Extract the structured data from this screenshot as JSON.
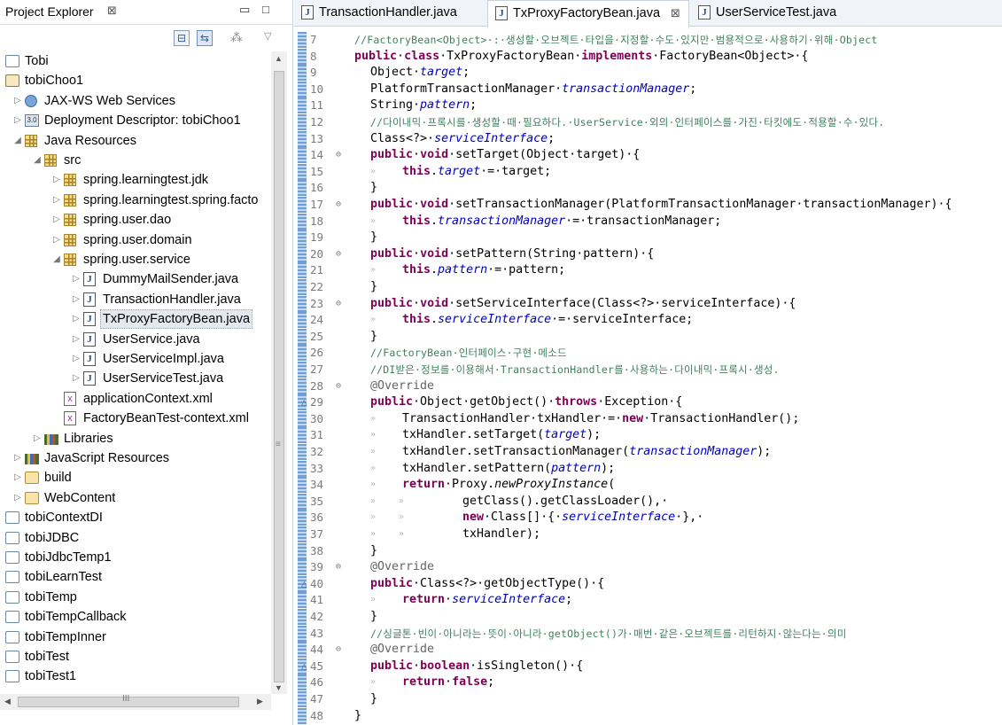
{
  "explorer": {
    "title": "Project Explorer",
    "close_glyph": "⊠",
    "items": [
      {
        "label": "Tobi",
        "icon": "project-folder-icon",
        "depth": 0,
        "twisty": ""
      },
      {
        "label": "tobiChoo1",
        "icon": "web-project-icon",
        "depth": 0,
        "twisty": ""
      },
      {
        "label": "JAX-WS Web Services",
        "icon": "web-services-icon",
        "depth": 1,
        "twisty": "▷"
      },
      {
        "label": "Deployment Descriptor: tobiChoo1",
        "icon": "deployment-descriptor-icon",
        "depth": 1,
        "twisty": "▷"
      },
      {
        "label": "Java Resources",
        "icon": "java-resources-icon",
        "depth": 1,
        "twisty": "◢"
      },
      {
        "label": "src",
        "icon": "source-folder-icon",
        "depth": 2,
        "twisty": "◢"
      },
      {
        "label": "spring.learningtest.jdk",
        "icon": "package-icon",
        "depth": 3,
        "twisty": "▷"
      },
      {
        "label": "spring.learningtest.spring.facto",
        "icon": "package-icon",
        "depth": 3,
        "twisty": "▷"
      },
      {
        "label": "spring.user.dao",
        "icon": "package-icon",
        "depth": 3,
        "twisty": "▷"
      },
      {
        "label": "spring.user.domain",
        "icon": "package-icon",
        "depth": 3,
        "twisty": "▷"
      },
      {
        "label": "spring.user.service",
        "icon": "package-icon",
        "depth": 3,
        "twisty": "◢"
      },
      {
        "label": "DummyMailSender.java",
        "icon": "java-file-icon",
        "depth": 4,
        "twisty": "▷"
      },
      {
        "label": "TransactionHandler.java",
        "icon": "java-file-icon",
        "depth": 4,
        "twisty": "▷"
      },
      {
        "label": "TxProxyFactoryBean.java",
        "icon": "java-file-icon",
        "depth": 4,
        "twisty": "▷",
        "selected": true
      },
      {
        "label": "UserService.java",
        "icon": "java-file-icon",
        "depth": 4,
        "twisty": "▷"
      },
      {
        "label": "UserServiceImpl.java",
        "icon": "java-file-icon",
        "depth": 4,
        "twisty": "▷"
      },
      {
        "label": "UserServiceTest.java",
        "icon": "java-file-icon",
        "depth": 4,
        "twisty": "▷"
      },
      {
        "label": "applicationContext.xml",
        "icon": "xml-file-icon",
        "depth": 3,
        "twisty": ""
      },
      {
        "label": "FactoryBeanTest-context.xml",
        "icon": "xml-file-icon",
        "depth": 3,
        "twisty": ""
      },
      {
        "label": "Libraries",
        "icon": "libraries-icon",
        "depth": 2,
        "twisty": "▷"
      },
      {
        "label": "JavaScript Resources",
        "icon": "javascript-resources-icon",
        "depth": 1,
        "twisty": "▷"
      },
      {
        "label": "build",
        "icon": "folder-icon",
        "depth": 1,
        "twisty": "▷"
      },
      {
        "label": "WebContent",
        "icon": "folder-icon",
        "depth": 1,
        "twisty": "▷"
      },
      {
        "label": "tobiContextDI",
        "icon": "project-folder-icon",
        "depth": 0,
        "twisty": ""
      },
      {
        "label": "tobiJDBC",
        "icon": "project-folder-icon",
        "depth": 0,
        "twisty": ""
      },
      {
        "label": "tobiJdbcTemp1",
        "icon": "project-folder-icon",
        "depth": 0,
        "twisty": ""
      },
      {
        "label": "tobiLearnTest",
        "icon": "project-folder-icon",
        "depth": 0,
        "twisty": ""
      },
      {
        "label": "tobiTemp",
        "icon": "project-folder-icon",
        "depth": 0,
        "twisty": ""
      },
      {
        "label": "tobiTempCallback",
        "icon": "project-folder-icon",
        "depth": 0,
        "twisty": ""
      },
      {
        "label": "tobiTempInner",
        "icon": "project-folder-icon",
        "depth": 0,
        "twisty": ""
      },
      {
        "label": "tobiTest",
        "icon": "project-folder-icon",
        "depth": 0,
        "twisty": ""
      },
      {
        "label": "tobiTest1",
        "icon": "project-folder-icon",
        "depth": 0,
        "twisty": ""
      }
    ]
  },
  "editor": {
    "tabs": [
      {
        "label": "TransactionHandler.java",
        "active": false
      },
      {
        "label": "TxProxyFactoryBean.java",
        "active": true,
        "close_glyph": "⊠"
      },
      {
        "label": "UserServiceTest.java",
        "active": false
      }
    ],
    "lines": [
      {
        "n": "7",
        "indent": 0,
        "segs": [
          [
            "c",
            "//FactoryBean<Object>·:·생성할·오브젝트·타입을·지정할·수도·있지만·범용적으로·사용하기·위해·Object"
          ]
        ]
      },
      {
        "n": "8",
        "indent": 0,
        "segs": [
          [
            "k",
            "public"
          ],
          [
            "t",
            "·"
          ],
          [
            "k",
            "class"
          ],
          [
            "t",
            "·TxProxyFactoryBean·"
          ],
          [
            "k",
            "implements"
          ],
          [
            "t",
            "·FactoryBean<Object>·{"
          ]
        ]
      },
      {
        "n": "9",
        "indent": 1,
        "segs": [
          [
            "t",
            "Object·"
          ],
          [
            "f",
            "target"
          ],
          [
            "t",
            ";"
          ]
        ]
      },
      {
        "n": "10",
        "indent": 1,
        "segs": [
          [
            "t",
            "PlatformTransactionManager·"
          ],
          [
            "f",
            "transactionManager"
          ],
          [
            "t",
            ";"
          ]
        ]
      },
      {
        "n": "11",
        "indent": 1,
        "segs": [
          [
            "t",
            "String·"
          ],
          [
            "f",
            "pattern"
          ],
          [
            "t",
            ";"
          ]
        ]
      },
      {
        "n": "12",
        "indent": 1,
        "segs": [
          [
            "c",
            "//다이내믹·프록시를·생성할·때·필요하다.·UserService·외의·인터페이스를·가진·타킷에도·적용할·수·있다."
          ]
        ]
      },
      {
        "n": "13",
        "indent": 1,
        "segs": [
          [
            "t",
            "Class<?>·"
          ],
          [
            "f",
            "serviceInterface"
          ],
          [
            "t",
            ";"
          ]
        ]
      },
      {
        "n": "14",
        "indent": 1,
        "fold": "⊖",
        "segs": [
          [
            "k",
            "public"
          ],
          [
            "t",
            "·"
          ],
          [
            "k",
            "void"
          ],
          [
            "t",
            "·setTarget(Object·target)·{"
          ]
        ]
      },
      {
        "n": "15",
        "indent": 2,
        "segs": [
          [
            "k",
            "this"
          ],
          [
            "t",
            "."
          ],
          [
            "f",
            "target"
          ],
          [
            "t",
            "·=·target;"
          ]
        ]
      },
      {
        "n": "16",
        "indent": 1,
        "segs": [
          [
            "t",
            "}"
          ]
        ]
      },
      {
        "n": "17",
        "indent": 1,
        "fold": "⊖",
        "segs": [
          [
            "k",
            "public"
          ],
          [
            "t",
            "·"
          ],
          [
            "k",
            "void"
          ],
          [
            "t",
            "·setTransactionManager(PlatformTransactionManager·transactionManager)·{"
          ]
        ]
      },
      {
        "n": "18",
        "indent": 2,
        "segs": [
          [
            "k",
            "this"
          ],
          [
            "t",
            "."
          ],
          [
            "f",
            "transactionManager"
          ],
          [
            "t",
            "·=·transactionManager;"
          ]
        ]
      },
      {
        "n": "19",
        "indent": 1,
        "segs": [
          [
            "t",
            "}"
          ]
        ]
      },
      {
        "n": "20",
        "indent": 1,
        "fold": "⊖",
        "segs": [
          [
            "k",
            "public"
          ],
          [
            "t",
            "·"
          ],
          [
            "k",
            "void"
          ],
          [
            "t",
            "·setPattern(String·pattern)·{"
          ]
        ]
      },
      {
        "n": "21",
        "indent": 2,
        "segs": [
          [
            "k",
            "this"
          ],
          [
            "t",
            "."
          ],
          [
            "f",
            "pattern"
          ],
          [
            "t",
            "·=·pattern;"
          ]
        ]
      },
      {
        "n": "22",
        "indent": 1,
        "segs": [
          [
            "t",
            "}"
          ]
        ]
      },
      {
        "n": "23",
        "indent": 1,
        "fold": "⊖",
        "segs": [
          [
            "k",
            "public"
          ],
          [
            "t",
            "·"
          ],
          [
            "k",
            "void"
          ],
          [
            "t",
            "·setServiceInterface(Class<?>·serviceInterface)·{"
          ]
        ]
      },
      {
        "n": "24",
        "indent": 2,
        "segs": [
          [
            "k",
            "this"
          ],
          [
            "t",
            "."
          ],
          [
            "f",
            "serviceInterface"
          ],
          [
            "t",
            "·=·serviceInterface;"
          ]
        ]
      },
      {
        "n": "25",
        "indent": 1,
        "segs": [
          [
            "t",
            "}"
          ]
        ]
      },
      {
        "n": "26",
        "indent": 1,
        "segs": [
          [
            "c",
            "//FactoryBean·인터페이스·구현·메소드"
          ]
        ]
      },
      {
        "n": "27",
        "indent": 1,
        "segs": [
          [
            "c",
            "//DI받은·정보를·이용해서·TransactionHandler를·사용하는·다이내믹·프록시·생성."
          ]
        ]
      },
      {
        "n": "28",
        "indent": 1,
        "fold": "⊖",
        "segs": [
          [
            "a",
            "@Override"
          ]
        ]
      },
      {
        "n": "29",
        "indent": 1,
        "ovr": "△",
        "segs": [
          [
            "k",
            "public"
          ],
          [
            "t",
            "·Object·getObject()·"
          ],
          [
            "k",
            "throws"
          ],
          [
            "t",
            "·Exception·{"
          ]
        ]
      },
      {
        "n": "30",
        "indent": 2,
        "segs": [
          [
            "t",
            "TransactionHandler·txHandler·=·"
          ],
          [
            "k",
            "new"
          ],
          [
            "t",
            "·TransactionHandler();"
          ]
        ]
      },
      {
        "n": "31",
        "indent": 2,
        "segs": [
          [
            "t",
            "txHandler.setTarget("
          ],
          [
            "f",
            "target"
          ],
          [
            "t",
            ");"
          ]
        ]
      },
      {
        "n": "32",
        "indent": 2,
        "segs": [
          [
            "t",
            "txHandler.setTransactionManager("
          ],
          [
            "f",
            "transactionManager"
          ],
          [
            "t",
            ");"
          ]
        ]
      },
      {
        "n": "33",
        "indent": 2,
        "segs": [
          [
            "t",
            "txHandler.setPattern("
          ],
          [
            "f",
            "pattern"
          ],
          [
            "t",
            ");"
          ]
        ]
      },
      {
        "n": "34",
        "indent": 2,
        "segs": [
          [
            "k",
            "return"
          ],
          [
            "t",
            "·Proxy."
          ],
          [
            "i",
            "newProxyInstance"
          ],
          [
            "t",
            "("
          ]
        ]
      },
      {
        "n": "35",
        "indent": 3,
        "segs": [
          [
            "t",
            "getClass().getClassLoader(),·"
          ]
        ]
      },
      {
        "n": "36",
        "indent": 3,
        "segs": [
          [
            "k",
            "new"
          ],
          [
            "t",
            "·Class[]·{·"
          ],
          [
            "f",
            "serviceInterface"
          ],
          [
            "t",
            "·},·"
          ]
        ]
      },
      {
        "n": "37",
        "indent": 3,
        "segs": [
          [
            "t",
            "txHandler);"
          ]
        ]
      },
      {
        "n": "38",
        "indent": 1,
        "segs": [
          [
            "t",
            "}"
          ]
        ]
      },
      {
        "n": "39",
        "indent": 1,
        "fold": "⊖",
        "segs": [
          [
            "a",
            "@Override"
          ]
        ]
      },
      {
        "n": "40",
        "indent": 1,
        "ovr": "△",
        "segs": [
          [
            "k",
            "public"
          ],
          [
            "t",
            "·Class<?>·getObjectType()·{"
          ]
        ]
      },
      {
        "n": "41",
        "indent": 2,
        "segs": [
          [
            "k",
            "return"
          ],
          [
            "t",
            "·"
          ],
          [
            "f",
            "serviceInterface"
          ],
          [
            "t",
            ";"
          ]
        ]
      },
      {
        "n": "42",
        "indent": 1,
        "segs": [
          [
            "t",
            "}"
          ]
        ]
      },
      {
        "n": "43",
        "indent": 1,
        "segs": [
          [
            "c",
            "//싱글톤·빈이·아니라는·뜻이·아니라·getObject()가·매번·같은·오브젝트를·리턴하지·않는다는·의미"
          ]
        ]
      },
      {
        "n": "44",
        "indent": 1,
        "fold": "⊖",
        "segs": [
          [
            "a",
            "@Override"
          ]
        ]
      },
      {
        "n": "45",
        "indent": 1,
        "ovr": "△",
        "segs": [
          [
            "k",
            "public"
          ],
          [
            "t",
            "·"
          ],
          [
            "k",
            "boolean"
          ],
          [
            "t",
            "·isSingleton()·{"
          ]
        ]
      },
      {
        "n": "46",
        "indent": 2,
        "segs": [
          [
            "k",
            "return"
          ],
          [
            "t",
            "·"
          ],
          [
            "k",
            "false"
          ],
          [
            "t",
            ";"
          ]
        ]
      },
      {
        "n": "47",
        "indent": 1,
        "segs": [
          [
            "t",
            "}"
          ]
        ]
      },
      {
        "n": "48",
        "indent": 0,
        "segs": [
          [
            "t",
            "}"
          ]
        ]
      }
    ]
  }
}
